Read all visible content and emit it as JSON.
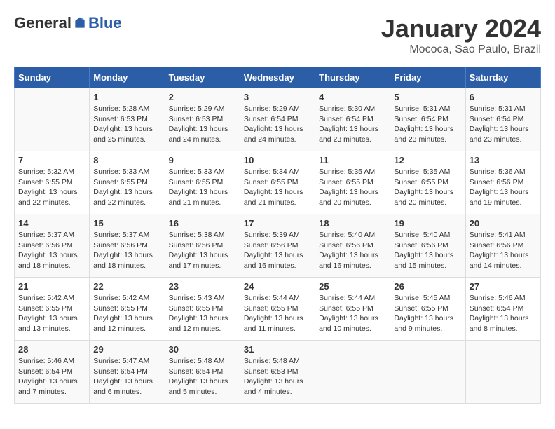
{
  "logo": {
    "general": "General",
    "blue": "Blue"
  },
  "title": "January 2024",
  "subtitle": "Mococa, Sao Paulo, Brazil",
  "days_of_week": [
    "Sunday",
    "Monday",
    "Tuesday",
    "Wednesday",
    "Thursday",
    "Friday",
    "Saturday"
  ],
  "weeks": [
    [
      {
        "day": "",
        "info": ""
      },
      {
        "day": "1",
        "info": "Sunrise: 5:28 AM\nSunset: 6:53 PM\nDaylight: 13 hours\nand 25 minutes."
      },
      {
        "day": "2",
        "info": "Sunrise: 5:29 AM\nSunset: 6:53 PM\nDaylight: 13 hours\nand 24 minutes."
      },
      {
        "day": "3",
        "info": "Sunrise: 5:29 AM\nSunset: 6:54 PM\nDaylight: 13 hours\nand 24 minutes."
      },
      {
        "day": "4",
        "info": "Sunrise: 5:30 AM\nSunset: 6:54 PM\nDaylight: 13 hours\nand 23 minutes."
      },
      {
        "day": "5",
        "info": "Sunrise: 5:31 AM\nSunset: 6:54 PM\nDaylight: 13 hours\nand 23 minutes."
      },
      {
        "day": "6",
        "info": "Sunrise: 5:31 AM\nSunset: 6:54 PM\nDaylight: 13 hours\nand 23 minutes."
      }
    ],
    [
      {
        "day": "7",
        "info": "Sunrise: 5:32 AM\nSunset: 6:55 PM\nDaylight: 13 hours\nand 22 minutes."
      },
      {
        "day": "8",
        "info": "Sunrise: 5:33 AM\nSunset: 6:55 PM\nDaylight: 13 hours\nand 22 minutes."
      },
      {
        "day": "9",
        "info": "Sunrise: 5:33 AM\nSunset: 6:55 PM\nDaylight: 13 hours\nand 21 minutes."
      },
      {
        "day": "10",
        "info": "Sunrise: 5:34 AM\nSunset: 6:55 PM\nDaylight: 13 hours\nand 21 minutes."
      },
      {
        "day": "11",
        "info": "Sunrise: 5:35 AM\nSunset: 6:55 PM\nDaylight: 13 hours\nand 20 minutes."
      },
      {
        "day": "12",
        "info": "Sunrise: 5:35 AM\nSunset: 6:55 PM\nDaylight: 13 hours\nand 20 minutes."
      },
      {
        "day": "13",
        "info": "Sunrise: 5:36 AM\nSunset: 6:56 PM\nDaylight: 13 hours\nand 19 minutes."
      }
    ],
    [
      {
        "day": "14",
        "info": "Sunrise: 5:37 AM\nSunset: 6:56 PM\nDaylight: 13 hours\nand 18 minutes."
      },
      {
        "day": "15",
        "info": "Sunrise: 5:37 AM\nSunset: 6:56 PM\nDaylight: 13 hours\nand 18 minutes."
      },
      {
        "day": "16",
        "info": "Sunrise: 5:38 AM\nSunset: 6:56 PM\nDaylight: 13 hours\nand 17 minutes."
      },
      {
        "day": "17",
        "info": "Sunrise: 5:39 AM\nSunset: 6:56 PM\nDaylight: 13 hours\nand 16 minutes."
      },
      {
        "day": "18",
        "info": "Sunrise: 5:40 AM\nSunset: 6:56 PM\nDaylight: 13 hours\nand 16 minutes."
      },
      {
        "day": "19",
        "info": "Sunrise: 5:40 AM\nSunset: 6:56 PM\nDaylight: 13 hours\nand 15 minutes."
      },
      {
        "day": "20",
        "info": "Sunrise: 5:41 AM\nSunset: 6:56 PM\nDaylight: 13 hours\nand 14 minutes."
      }
    ],
    [
      {
        "day": "21",
        "info": "Sunrise: 5:42 AM\nSunset: 6:55 PM\nDaylight: 13 hours\nand 13 minutes."
      },
      {
        "day": "22",
        "info": "Sunrise: 5:42 AM\nSunset: 6:55 PM\nDaylight: 13 hours\nand 12 minutes."
      },
      {
        "day": "23",
        "info": "Sunrise: 5:43 AM\nSunset: 6:55 PM\nDaylight: 13 hours\nand 12 minutes."
      },
      {
        "day": "24",
        "info": "Sunrise: 5:44 AM\nSunset: 6:55 PM\nDaylight: 13 hours\nand 11 minutes."
      },
      {
        "day": "25",
        "info": "Sunrise: 5:44 AM\nSunset: 6:55 PM\nDaylight: 13 hours\nand 10 minutes."
      },
      {
        "day": "26",
        "info": "Sunrise: 5:45 AM\nSunset: 6:55 PM\nDaylight: 13 hours\nand 9 minutes."
      },
      {
        "day": "27",
        "info": "Sunrise: 5:46 AM\nSunset: 6:54 PM\nDaylight: 13 hours\nand 8 minutes."
      }
    ],
    [
      {
        "day": "28",
        "info": "Sunrise: 5:46 AM\nSunset: 6:54 PM\nDaylight: 13 hours\nand 7 minutes."
      },
      {
        "day": "29",
        "info": "Sunrise: 5:47 AM\nSunset: 6:54 PM\nDaylight: 13 hours\nand 6 minutes."
      },
      {
        "day": "30",
        "info": "Sunrise: 5:48 AM\nSunset: 6:54 PM\nDaylight: 13 hours\nand 5 minutes."
      },
      {
        "day": "31",
        "info": "Sunrise: 5:48 AM\nSunset: 6:53 PM\nDaylight: 13 hours\nand 4 minutes."
      },
      {
        "day": "",
        "info": ""
      },
      {
        "day": "",
        "info": ""
      },
      {
        "day": "",
        "info": ""
      }
    ]
  ]
}
